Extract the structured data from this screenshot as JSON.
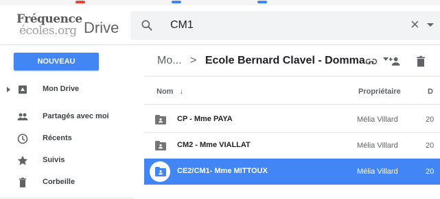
{
  "logo": {
    "line1": "Fréquence",
    "line2": "écoles.org"
  },
  "app": {
    "title": "Drive"
  },
  "search": {
    "value": "CM1",
    "icon": "search-icon",
    "clear_glyph": "×"
  },
  "toolbar": {
    "new_button": "NOUVEAU",
    "breadcrumb_parent": "Mo...",
    "breadcrumb_separator": ">",
    "breadcrumb_current": "Ecole Bernard Clavel - Domma...",
    "icons": [
      "link-icon",
      "share-person-icon",
      "trash-icon"
    ]
  },
  "sidebar": {
    "items": [
      {
        "label": "Mon Drive",
        "icon": "drive-icon",
        "expandable": true
      },
      {
        "label": "Partagés avec moi",
        "icon": "people-icon"
      },
      {
        "label": "Récents",
        "icon": "clock-icon"
      },
      {
        "label": "Suivis",
        "icon": "star-icon"
      },
      {
        "label": "Corbeille",
        "icon": "trash-icon"
      }
    ]
  },
  "list": {
    "headers": {
      "name": "Nom",
      "sort_glyph": "↓",
      "owner": "Propriétaire",
      "date": "D"
    },
    "rows": [
      {
        "name": "CP - Mme PAYA",
        "owner": "Mélia Villard",
        "date": "20",
        "icon": "shared-folder-icon",
        "selected": false
      },
      {
        "name": "CM2 - Mme VIALLAT",
        "owner": "Mélia Villard",
        "date": "20",
        "icon": "shared-folder-icon",
        "selected": false
      },
      {
        "name": "CE2/CM1- Mme MITTOUX",
        "owner": "Mélia Villard",
        "date": "20",
        "icon": "shared-folder-icon",
        "selected": true
      }
    ]
  },
  "colors": {
    "accent": "#4285f4",
    "selected_row": "#4285f4",
    "text": "#212121",
    "muted": "#5f6368"
  }
}
